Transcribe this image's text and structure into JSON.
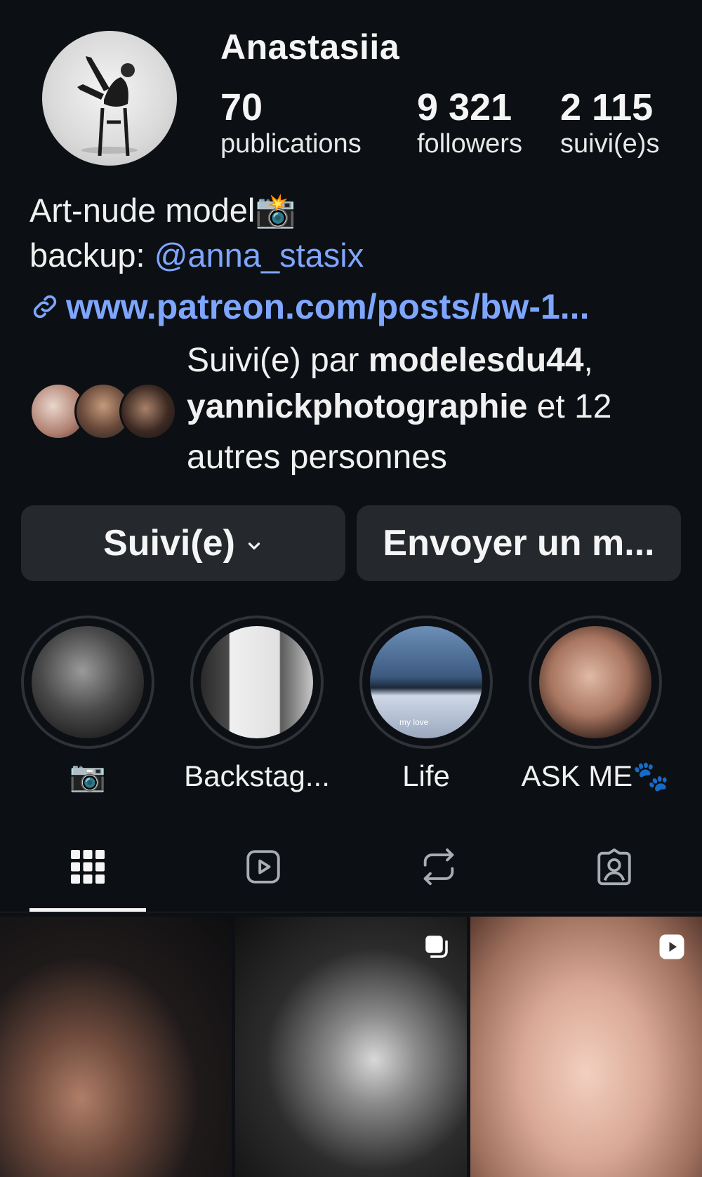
{
  "profile": {
    "username": "Anastasiia",
    "stats": [
      {
        "value": "70",
        "label": "publications"
      },
      {
        "value": "9 321",
        "label": "followers"
      },
      {
        "value": "2 115",
        "label": "suivi(e)s"
      }
    ],
    "bio_line1": "Art-nude model📸",
    "bio_line2_prefix": "backup: ",
    "bio_mention": "@anna_stasix",
    "link_text": "www.patreon.com/posts/bw-1...",
    "mutual_prefix": "Suivi(e) par ",
    "mutual_user1": "modelesdu44",
    "mutual_sep": ",",
    "mutual_user2": "yannickphotographie",
    "mutual_suffix": " et 12",
    "mutual_line3": "autres personnes"
  },
  "actions": {
    "follow_label": "Suivi(e)",
    "message_label": "Envoyer un m..."
  },
  "highlights": [
    {
      "label": "📷"
    },
    {
      "label": "Backstag..."
    },
    {
      "label": "Life",
      "overlay_text": "my love"
    },
    {
      "label": "ASK ME🐾"
    }
  ],
  "tabs": [
    "grid-icon",
    "reels-icon",
    "reposts-icon",
    "tagged-icon"
  ],
  "colors": {
    "background": "#0c1014",
    "button": "#25292e",
    "link": "#7fa6ff"
  }
}
